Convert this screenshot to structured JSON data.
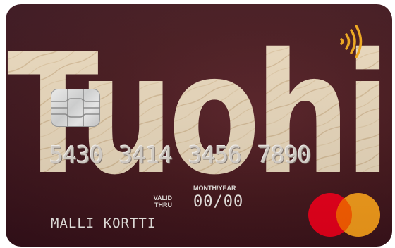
{
  "card": {
    "brand_name": "Tuohi",
    "number": "5430 3414 3456 7890",
    "valid_thru_line1": "VALID",
    "valid_thru_line2": "THRU",
    "month_year_label": "MONTH/YEAR",
    "expiry": "00/00",
    "cardholder": "MALLI KORTTI"
  },
  "icons": {
    "chip": "emv-chip-icon",
    "contactless": "contactless-icon",
    "network_logo": "mastercard-logo"
  },
  "colors": {
    "card_background": "#46181d",
    "brand_wood": "#e9dcc4",
    "contactless": "#f0a81a",
    "mastercard_red": "#eb001b",
    "mastercard_orange": "#f79e1b",
    "mastercard_overlap": "#ff5f00"
  }
}
